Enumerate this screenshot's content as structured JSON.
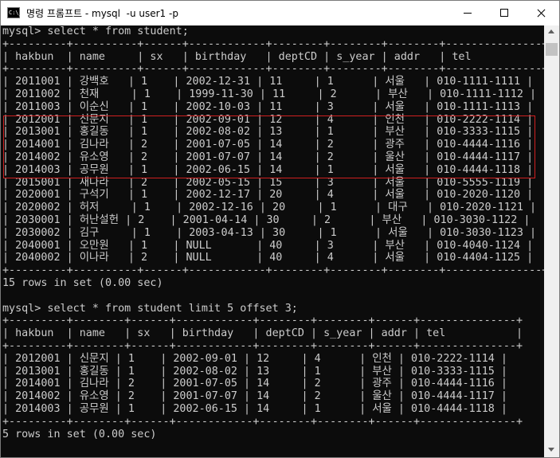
{
  "window": {
    "title": "명령 프롬프트 - mysql  -u user1 -p",
    "icon": "C:\\_"
  },
  "console": {
    "text": "mysql> select * from student;\n+---------+----------+------+------------+--------+--------+--------+---------------+\n| hakbun  | name     | sx   | birthday   | deptCD | s_year | addr   | tel           |\n+---------+----------+------+------------+--------+--------+--------+---------------+\n| 2011001 | 강백호   | 1    | 2002-12-31 | 11     | 1      | 서울   | 010-1111-1111 |\n| 2011002 | 천재     | 1    | 1999-11-30 | 11     | 2      | 부산   | 010-1111-1112 |\n| 2011003 | 이순신   | 1    | 2002-10-03 | 11     | 3      | 서울   | 010-1111-1113 |\n| 2012001 | 신문지   | 1    | 2002-09-01 | 12     | 4      | 인천   | 010-2222-1114 |\n| 2013001 | 홍길동   | 1    | 2002-08-02 | 13     | 1      | 부산   | 010-3333-1115 |\n| 2014001 | 김나라   | 2    | 2001-07-05 | 14     | 2      | 광주   | 010-4444-1116 |\n| 2014002 | 유소영   | 2    | 2001-07-07 | 14     | 2      | 울산   | 010-4444-1117 |\n| 2014003 | 공무원   | 1    | 2002-06-15 | 14     | 1      | 서울   | 010-4444-1118 |\n| 2015001 | 새나라   | 2    | 2002-05-15 | 15     | 3      | 서울   | 010-5555-1119 |\n| 2020001 | 구석기   | 1    | 2002-12-17 | 20     | 4      | 서울   | 010-2020-1120 |\n| 2020002 | 허저     | 1    | 2002-12-16 | 20     | 1      | 대구   | 010-2020-1121 |\n| 2030001 | 허난설헌 | 2    | 2001-04-14 | 30     | 2      | 부산   | 010-3030-1122 |\n| 2030002 | 김구     | 1    | 2003-04-13 | 30     | 1      | 서울   | 010-3030-1123 |\n| 2040001 | 오만원   | 1    | NULL       | 40     | 3      | 부산   | 010-4040-1124 |\n| 2040002 | 이나라   | 2    | NULL       | 40     | 4      | 서울   | 010-4404-1125 |\n+---------+----------+------+------------+--------+--------+--------+---------------+\n15 rows in set (0.00 sec)\n\nmysql> select * from student limit 5 offset 3;\n+---------+--------+------+------------+--------+--------+------+---------------+\n| hakbun  | name   | sx   | birthday   | deptCD | s_year | addr | tel           |\n+---------+--------+------+------------+--------+--------+------+---------------+\n| 2012001 | 신문지 | 1    | 2002-09-01 | 12     | 4      | 인천 | 010-2222-1114 |\n| 2013001 | 홍길동 | 1    | 2002-08-02 | 13     | 1      | 부산 | 010-3333-1115 |\n| 2014001 | 김나라 | 2    | 2001-07-05 | 14     | 2      | 광주 | 010-4444-1116 |\n| 2014002 | 유소영 | 2    | 2001-07-07 | 14     | 2      | 울산 | 010-4444-1117 |\n| 2014003 | 공무원 | 1    | 2002-06-15 | 14     | 1      | 서울 | 010-4444-1118 |\n+---------+--------+------+------------+--------+--------+------+---------------+\n5 rows in set (0.00 sec)"
  },
  "colors": {
    "console_bg": "#0c0c0c",
    "console_fg": "#cccccc",
    "highlight_border": "#d02020"
  }
}
